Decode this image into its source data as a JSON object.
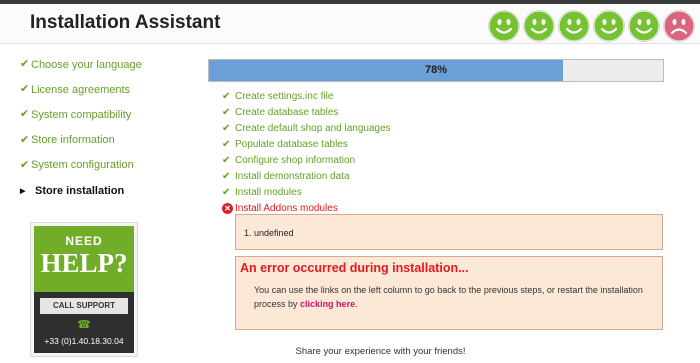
{
  "app": {
    "title": "Installation Assistant"
  },
  "mood": {
    "icons": [
      "smiley-happy-icon",
      "smiley-happy-icon",
      "smiley-happy-icon",
      "smiley-happy-icon",
      "smiley-happy-icon",
      "smiley-sad-icon"
    ],
    "colors": {
      "happy": "#77c232",
      "sad": "#d9657f"
    }
  },
  "sidebar": {
    "steps": [
      {
        "label": "Choose your language",
        "done": true
      },
      {
        "label": "License agreements",
        "done": true
      },
      {
        "label": "System compatibility",
        "done": true
      },
      {
        "label": "Store information",
        "done": true
      },
      {
        "label": "System configuration",
        "done": true
      },
      {
        "label": "Store installation",
        "done": false,
        "current": true
      }
    ]
  },
  "help": {
    "need": "NEED",
    "help": "HELP?",
    "call": "CALL SUPPORT",
    "phone": "+33 (0)1.40.18.30.04",
    "icon": "phone-icon"
  },
  "progress": {
    "value": 78,
    "label": "78%"
  },
  "tasks": [
    {
      "label": "Create settings.inc file",
      "status": "done"
    },
    {
      "label": "Create database tables",
      "status": "done"
    },
    {
      "label": "Create default shop and languages",
      "status": "done"
    },
    {
      "label": "Populate database tables",
      "status": "done"
    },
    {
      "label": "Configure shop information",
      "status": "done"
    },
    {
      "label": "Install demonstration data",
      "status": "done"
    },
    {
      "label": "Install modules",
      "status": "done"
    },
    {
      "label": "Install Addons modules",
      "status": "failed"
    }
  ],
  "error_list": {
    "items": [
      "1.   undefined"
    ]
  },
  "error": {
    "title": "An error occurred during installation...",
    "message": "You can use the links on the left column to go back to the previous steps, or restart the installation process by",
    "link": "clicking here",
    "end": "."
  },
  "footer": {
    "share": "Share your experience with your friends!"
  },
  "colors": {
    "green": "#67a028",
    "error_red": "#e3191f",
    "link_pink": "#d01367",
    "progress_blue": "#6b9fd6",
    "error_bg": "#fce8d6"
  }
}
